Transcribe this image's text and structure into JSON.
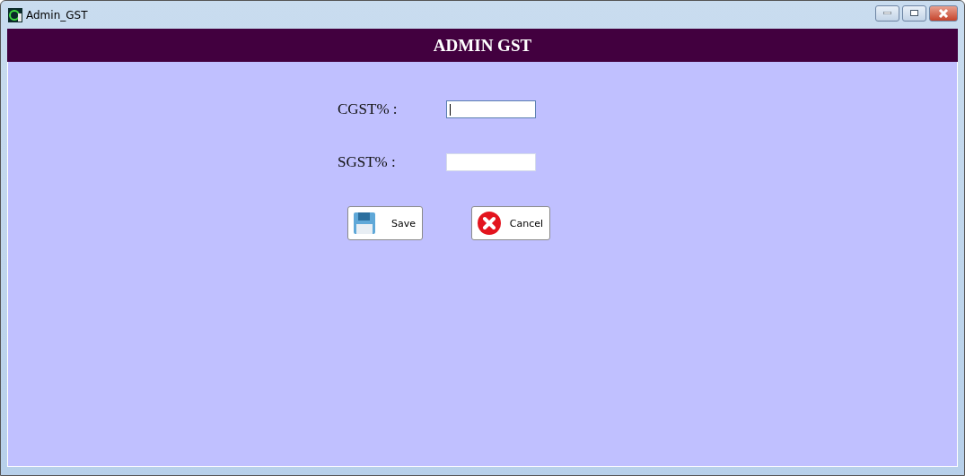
{
  "window": {
    "title": "Admin_GST"
  },
  "header": {
    "title": "ADMIN GST"
  },
  "fields": [
    {
      "label": "CGST% :",
      "focused": true
    },
    {
      "label": "SGST% :",
      "focused": false
    }
  ],
  "buttons": [
    {
      "kind": "save",
      "label": "Save"
    },
    {
      "kind": "cancel",
      "label": "Cancel"
    }
  ]
}
